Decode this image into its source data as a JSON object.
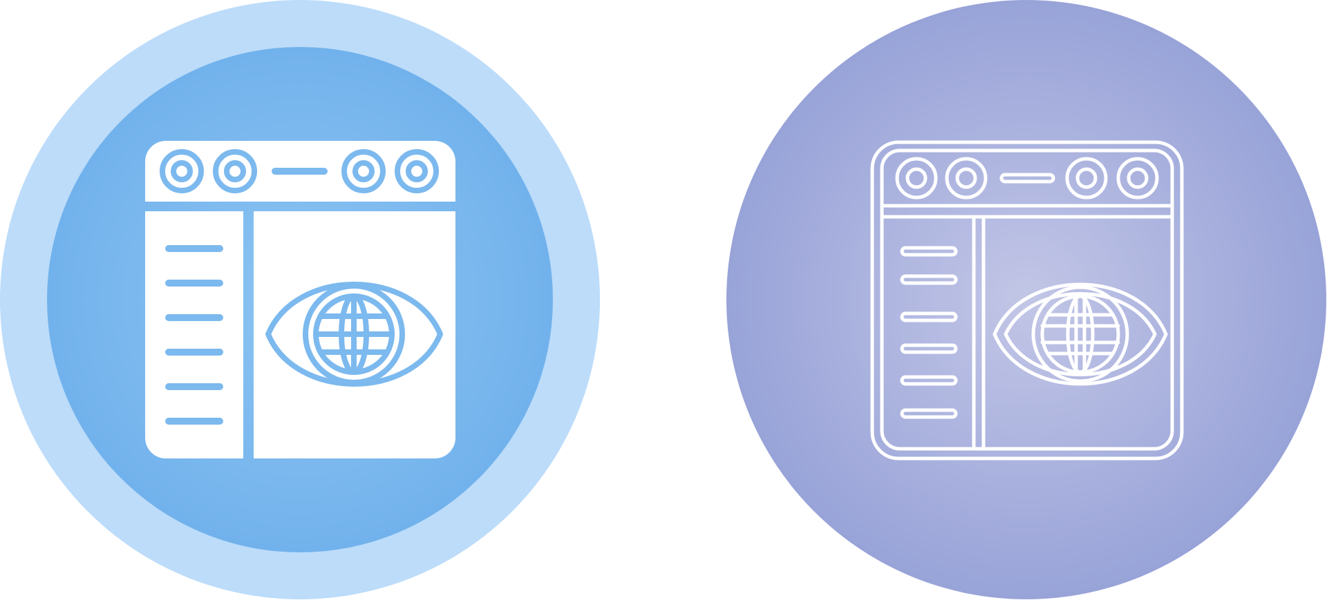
{
  "icons": [
    {
      "name": "web-monitoring-icon",
      "style": "glyph",
      "colors": {
        "outer_circle": "#bcdcfa",
        "inner_circle_light": "#8cc4f2",
        "inner_circle_dark": "#72b2ec",
        "fill": "#ffffff",
        "detail": "#7cb9ee"
      },
      "list_lines": 6
    },
    {
      "name": "web-monitoring-icon",
      "style": "outline",
      "colors": {
        "circle_center": "#c2c6e6",
        "circle_edge": "#98a3d8",
        "stroke": "#ffffff"
      },
      "list_lines": 6
    }
  ]
}
